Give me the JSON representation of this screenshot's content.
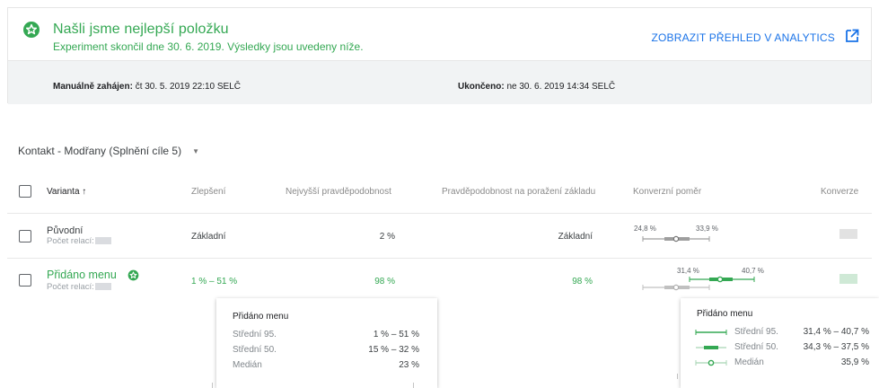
{
  "banner": {
    "title": "Našli jsme nejlepší položku",
    "subtitle": "Experiment skončil dne 30. 6. 2019. Výsledky jsou uvedeny níže.",
    "analytics_link": "ZOBRAZIT PŘEHLED V ANALYTICS",
    "started_label": "Manuálně zahájen:",
    "started_value": "čt 30. 5. 2019 22:10 SELČ",
    "ended_label": "Ukončeno:",
    "ended_value": "ne 30. 6. 2019 14:34 SELČ",
    "accent_color": "#34a853",
    "link_color": "#1a73e8"
  },
  "objective": {
    "label": "Kontakt - Modřany (Splnění cíle 5)",
    "caret": "▼"
  },
  "table": {
    "headers": {
      "variant": "Varianta ↑",
      "improvement": "Zlepšení",
      "best_probability": "Nejvyšší pravděpodobnost",
      "beat_baseline": "Pravděpodobnost na poražení základu",
      "conversion_rate": "Konverzní poměr",
      "conversions": "Konverze"
    },
    "rows": [
      {
        "name": "Původní",
        "sessions_label": "Počet relací:",
        "improvement": "Základní",
        "best_probability": "2 %",
        "beat_baseline": "Základní",
        "ci_low": "24,8 %",
        "ci_high": "33,9 %"
      },
      {
        "name": "Přidáno menu",
        "sessions_label": "Počet relací:",
        "improvement": "1 % – 51 %",
        "best_probability": "98 %",
        "beat_baseline": "98 %",
        "ci_low": "31,4 %",
        "ci_high": "40,7 %"
      }
    ]
  },
  "tooltip_left": {
    "title": "Přidáno menu",
    "rows": [
      {
        "label": "Střední 95.",
        "value": "1 % – 51 %"
      },
      {
        "label": "Střední 50.",
        "value": "15 % – 32 %"
      },
      {
        "label": "Medián",
        "value": "23 %"
      }
    ]
  },
  "tooltip_right": {
    "title": "Přidáno menu",
    "rows": [
      {
        "label": "Střední 95.",
        "value": "31,4 % – 40,7 %"
      },
      {
        "label": "Střední 50.",
        "value": "34,3 % – 37,5 %"
      },
      {
        "label": "Medián",
        "value": "35,9 %"
      }
    ]
  }
}
